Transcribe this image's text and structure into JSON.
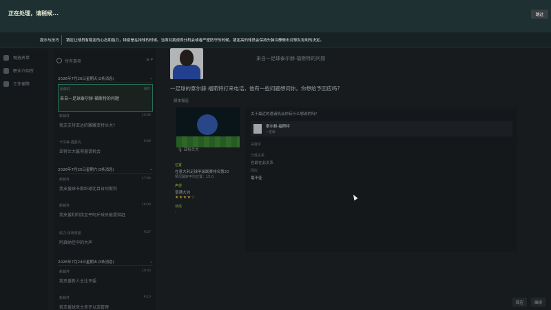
{
  "overlay": {
    "title": "正在处理，请稍候...",
    "skip_label": "跳过",
    "tip_label": "提示与技巧",
    "tip_text": "镇定让球员有稳定的心态和能力，特别是在持球的时候。当面对挑战得分机会或者严密防守的时候，镇定高的球员会保持头脑冷静做出对球队有利的决定。"
  },
  "sidebar": {
    "items": [
      {
        "label": "观选名单"
      },
      {
        "label": "职业介绍所"
      },
      {
        "label": "工作保障"
      }
    ]
  },
  "inbox": {
    "search_placeholder": "所有事项",
    "filter_label": "≡ ▾",
    "groups": [
      {
        "date": "2026年7月26日星期天(2条消息)"
      },
      {
        "date": "2026年7月25日星期六(3条消息)"
      },
      {
        "date": "2026年7月24日星期五(3条消息)"
      }
    ],
    "messages": [
      {
        "sender": "新邮件",
        "title": "来自一足球泰尔赫·福斯特的问题",
        "time": "最新"
      },
      {
        "sender": "新邮件",
        "title": "我支支持亚达的雕雕变特兰大?",
        "time": "10:00"
      },
      {
        "sender": "卡尔森·福曼内",
        "title": "亚特兰大赢得邀请机会",
        "time": "9:00"
      },
      {
        "sender": "新邮件",
        "title": "我支援球卡斯卧球比目日阿斯利",
        "time": "17:04"
      },
      {
        "sender": "新邮件",
        "title": "我支援利利我至平阿斤球员能提供赶",
        "time": "16:00"
      },
      {
        "sender": "助力·体育周报",
        "title": "阿森纳佳中的大声",
        "time": "9:27"
      },
      {
        "sender": "新邮件",
        "title": "我支援新人主比评委",
        "time": "10:03"
      },
      {
        "sender": "新邮件",
        "title": "我支援球来主来评以选管理",
        "time": "9:10"
      }
    ]
  },
  "main": {
    "from": "来自一足球泰尔赫·福斯特的问题",
    "question": "一足球的泰尔赫·福斯特打来电话，他有一些问题想问你。你想给予回应吗?",
    "media_label": "媒体报道",
    "club": "亚特兰大",
    "info": {
      "rank_label": "位置",
      "rank_value": "在意大利足球甲级联赛排名第20",
      "rank_sub": "情况最好平均位置：15.0",
      "rep_label": "声望",
      "rep_value": "普通大洲",
      "stars": "★★★★☆",
      "status_label": "状态",
      "status_value": "-"
    }
  },
  "reply": {
    "prompt": "关于最近的邀请机会你有什么想说的吗?",
    "person_name": "泰尔赫·福斯特",
    "person_sub": "一足球",
    "rows": [
      {
        "label": "关键字",
        "value": ""
      },
      {
        "label": "已经关系",
        "value": "也最在此关系"
      },
      {
        "label": "回应",
        "value": "毫不佳"
      }
    ]
  },
  "buttons": {
    "back": "回应",
    "confirm": "继续"
  }
}
